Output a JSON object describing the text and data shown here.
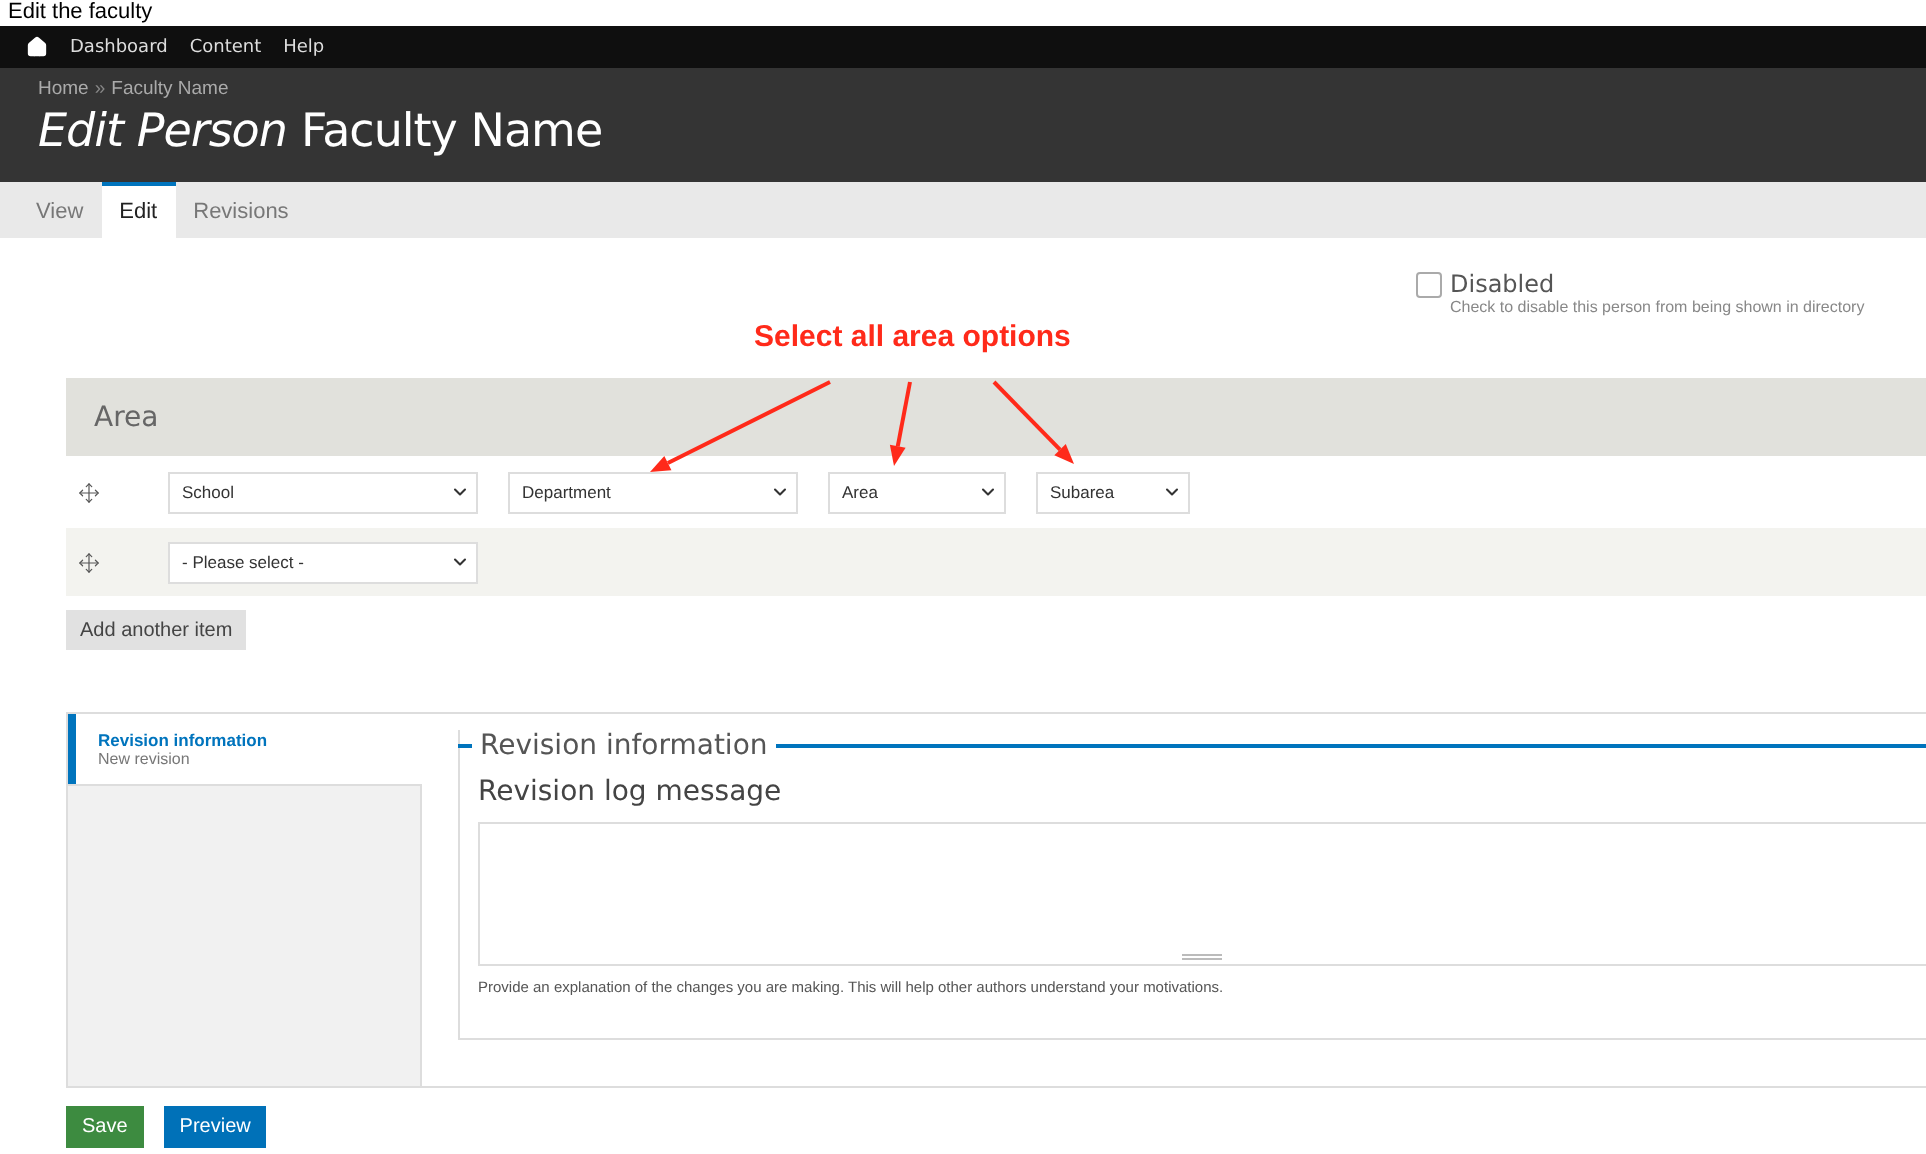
{
  "caption": "Edit the faculty",
  "toolbar": {
    "items": [
      "Dashboard",
      "Content",
      "Help"
    ]
  },
  "header": {
    "breadcrumb": [
      "Home",
      "Faculty Name"
    ],
    "breadcrumb_separator": "»",
    "title_type": "Edit Person",
    "title_name": "Faculty Name"
  },
  "tabs": [
    {
      "label": "View",
      "selected": false
    },
    {
      "label": "Edit",
      "selected": true
    },
    {
      "label": "Revisions",
      "selected": false
    }
  ],
  "disabled_field": {
    "label": "Disabled",
    "checked": false,
    "description": "Check to disable this person from being shown in directory"
  },
  "annotation": {
    "text": "Select all area options"
  },
  "area": {
    "title": "Area",
    "rows": [
      {
        "selects": [
          "School",
          "Department",
          "Area",
          "Subarea"
        ]
      },
      {
        "selects": [
          "- Please select -"
        ]
      }
    ],
    "add_button": "Add another item"
  },
  "revision": {
    "vertical_tab": {
      "title": "Revision information",
      "summary": "New revision",
      "selected": true
    },
    "legend": "Revision information",
    "log_label": "Revision log message",
    "description": "Provide an explanation of the changes you are making. This will help other authors understand your motivations."
  },
  "actions": [
    {
      "label": "Save",
      "kind": "primary"
    },
    {
      "label": "Preview",
      "kind": "secondary"
    }
  ]
}
